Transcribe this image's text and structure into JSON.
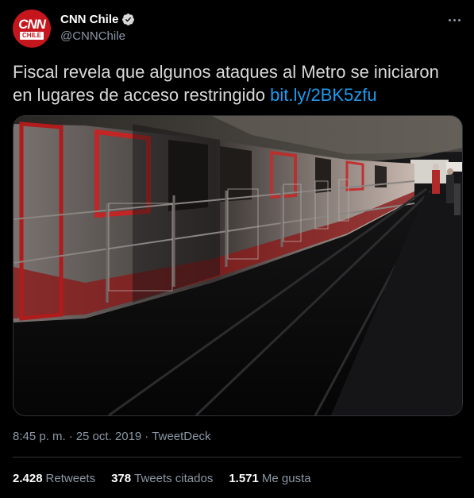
{
  "author": {
    "display_name": "CNN Chile",
    "handle": "@CNNChile",
    "avatar_logo": "CNN",
    "avatar_sub": "CHILE",
    "verified_icon": "verified-badge-icon"
  },
  "tweet": {
    "text": "Fiscal revela que algunos ataques al Metro se iniciaron en lugares de acceso restringido",
    "link": "bit.ly/2BK5zfu",
    "time": "8:45 p. m.",
    "date": "25 oct. 2019",
    "source": "TweetDeck",
    "separator": "·"
  },
  "stats": {
    "retweets_count": "2.428",
    "retweets_label": "Retweets",
    "quotes_count": "378",
    "quotes_label": "Tweets citados",
    "likes_count": "1.571",
    "likes_label": "Me gusta"
  },
  "colors": {
    "background": "#000000",
    "link": "#1d9bf0",
    "muted": "#8b98a5",
    "avatar_red": "#c4161c"
  }
}
